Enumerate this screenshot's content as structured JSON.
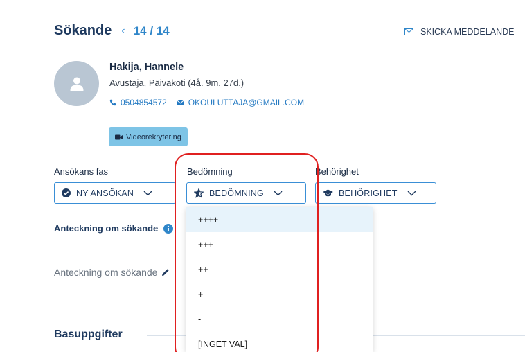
{
  "header": {
    "title": "Sökande",
    "counter": "14 / 14",
    "send_message": "SKICKA MEDDELANDE"
  },
  "applicant": {
    "name": "Hakija, Hannele",
    "subtitle": "Avustaja, Päiväkoti (4å. 9m. 27d.)",
    "phone": "0504854572",
    "email": "OKOULUTTAJA@GMAIL.COM"
  },
  "badge": {
    "label": "Videorekrytering"
  },
  "fields": {
    "phase_label": "Ansökans fas",
    "phase_value": "NY ANSÖKAN",
    "rating_label": "Bedömning",
    "rating_value": "BEDÖMNING",
    "eligibility_label": "Behörighet",
    "eligibility_value": "BEHÖRIGHET"
  },
  "note": {
    "label": "Anteckning om sökande",
    "placeholder": "Anteckning om sökande"
  },
  "section": {
    "title": "Basuppgifter"
  },
  "rating_menu": {
    "items": [
      "++++",
      "+++",
      "++",
      "+",
      "-",
      "[INGET VAL]"
    ]
  },
  "colors": {
    "accent": "#3a8fd6",
    "title": "#1f3a5f",
    "badge": "#7ec4e6",
    "highlight": "#e02020"
  }
}
